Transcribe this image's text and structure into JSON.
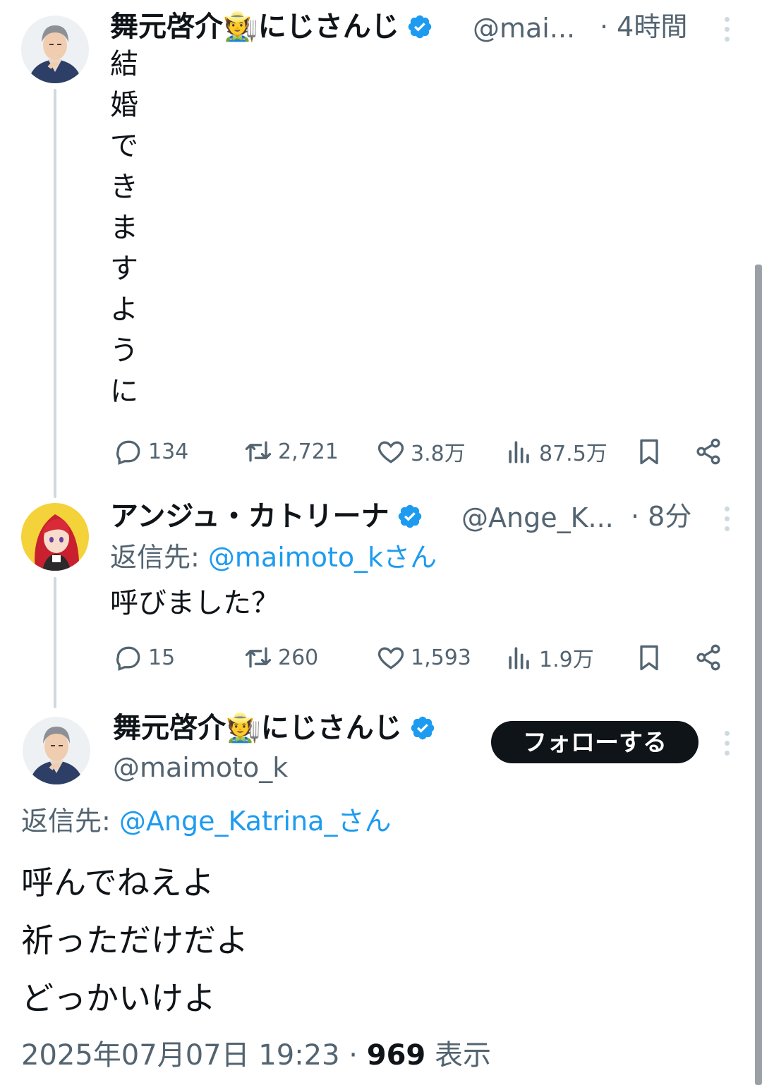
{
  "colors": {
    "accent": "#1d9bf0",
    "text": "#0f1419",
    "muted": "#536471",
    "line": "#cfd9de"
  },
  "tweet1": {
    "name": "舞元啓介🧑‍🌾にじさんじ",
    "handle": "@mai...",
    "time": "· 4時間",
    "text_chars": [
      "結",
      "婚",
      "で",
      "き",
      "ま",
      "す",
      "よ",
      "う",
      "に"
    ],
    "replies": "134",
    "retweets": "2,721",
    "likes": "3.8万",
    "views": "87.5万"
  },
  "tweet2": {
    "name": "アンジュ・カトリーナ",
    "handle": "@Ange_K...",
    "time": "· 8分",
    "reply_prefix": "返信先: ",
    "reply_mention": "@maimoto_kさん",
    "text": "呼びました？",
    "replies": "15",
    "retweets": "260",
    "likes": "1,593",
    "views": "1.9万"
  },
  "main": {
    "name": "舞元啓介🧑‍🌾にじさんじ",
    "handle": "@maimoto_k",
    "follow_label": "フォローする",
    "reply_prefix": "返信先: ",
    "reply_mention": "@Ange_Katrina_さん",
    "lines": [
      "呼んでねえよ",
      "祈っただけだよ",
      "どっかいけよ"
    ],
    "datetime": "2025年07月07日 19:23 · ",
    "views_count": "969",
    "views_label": " 表示"
  }
}
